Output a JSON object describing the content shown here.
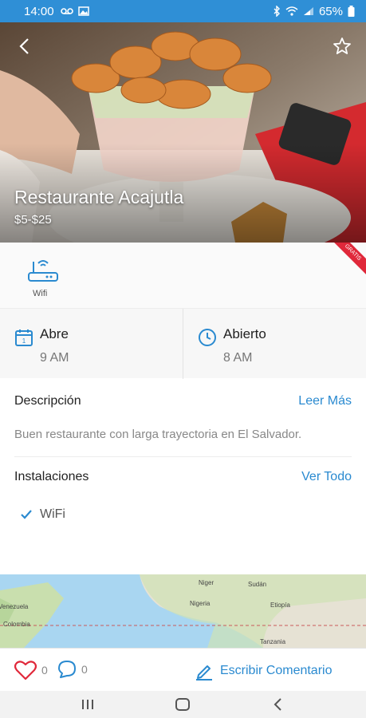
{
  "status_bar": {
    "time": "14:00",
    "battery": "65%"
  },
  "restaurant": {
    "name": "Restaurante Acajutla",
    "price_range": "$5-$25",
    "badge": "GRATIS"
  },
  "amenities": [
    {
      "icon": "wifi-router-icon",
      "label": "Wifi"
    }
  ],
  "hours": {
    "opens_label": "Abre",
    "opens_value": "9 AM",
    "status_label": "Abierto",
    "status_value": "8 AM"
  },
  "description": {
    "title": "Descripción",
    "link": "Leer Más",
    "text": "Buen restaurante con larga trayectoria en El Salvador."
  },
  "facilities": {
    "title": "Instalaciones",
    "link": "Ver Todo",
    "items": [
      {
        "icon": "check-icon",
        "label": "WiFi"
      }
    ]
  },
  "map": {
    "labels": [
      "Niger",
      "Sudán",
      "Nigeria",
      "Etiopía",
      "Venezuela",
      "Colombia",
      "Tanzania"
    ]
  },
  "actions": {
    "likes": "0",
    "comments": "0",
    "write_label": "Escribir Comentario"
  },
  "colors": {
    "accent": "#2a8ad0",
    "status_bar": "#2f8fd6",
    "badge": "#e0283a",
    "heart": "#e0283a"
  }
}
